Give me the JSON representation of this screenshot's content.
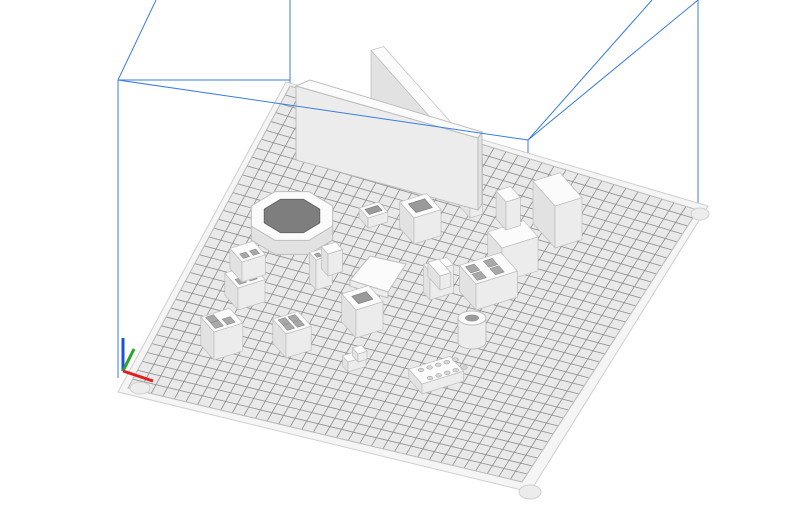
{
  "app": {
    "view": "3d-perspective",
    "scene": "build-plate-with-printable-objects"
  },
  "colors": {
    "background": "#ffffff",
    "plate_fill": "#e9e9e9",
    "plate_rim": "#f4f4f4",
    "grid_line": "#8a8a8a",
    "build_volume_outline": "#3a7de0",
    "object_top": "#fbfbfb",
    "object_side_left": "#e2e2e2",
    "object_side_right": "#ececec",
    "object_edge": "#bdbdbd",
    "axis_x": "#e02020",
    "axis_y": "#2aa52a",
    "axis_z": "#2050e0"
  },
  "icons": {
    "axis_indicator": "xyz-axis-icon",
    "plate_feet": "plate-foot-icon"
  },
  "objects": [
    {
      "name": "tall-wall-panel"
    },
    {
      "name": "octagon-ring"
    },
    {
      "name": "small-open-box"
    },
    {
      "name": "cube-with-cavity"
    },
    {
      "name": "stacked-blocks-large"
    },
    {
      "name": "stacked-blocks-small"
    },
    {
      "name": "l-bracket-rail"
    },
    {
      "name": "wedge-block"
    },
    {
      "name": "corner-bracket"
    },
    {
      "name": "grid-box-four-holes"
    },
    {
      "name": "grid-block-two-holes"
    },
    {
      "name": "hollow-cube-large"
    },
    {
      "name": "hollow-cube-small"
    },
    {
      "name": "hollow-square-block"
    },
    {
      "name": "hex-nut-cylinder"
    },
    {
      "name": "small-step-block"
    },
    {
      "name": "lego-brick-plate"
    },
    {
      "name": "cube-with-holes"
    }
  ]
}
